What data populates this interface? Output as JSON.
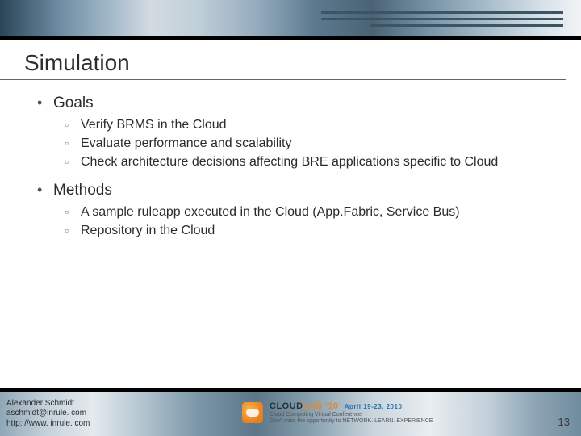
{
  "title": "Simulation",
  "sections": [
    {
      "heading": "Goals",
      "items": [
        "Verify BRMS in the Cloud",
        "Evaluate performance and scalability",
        "Check architecture decisions affecting BRE applications specific to Cloud"
      ]
    },
    {
      "heading": "Methods",
      "items": [
        "A sample ruleapp executed in the Cloud (App.Fabric, Service Bus)",
        "Repository in the Cloud"
      ]
    }
  ],
  "footer": {
    "author_name": "Alexander Schmidt",
    "author_email": "aschmidt@inrule. com",
    "author_url": "http: //www. inrule. com",
    "event_title_a": "CLOUD",
    "event_title_b": "LAB '10",
    "event_tagline": "Cloud Computing Virtual Conference",
    "event_dates": "April 19-23, 2010",
    "event_cta": "Don't miss the opportunity to NETWORK. LEARN. EXPERIENCE"
  },
  "page_number": "13"
}
